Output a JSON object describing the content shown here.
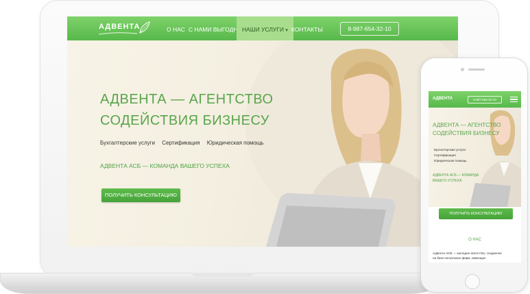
{
  "desktop": {
    "logo": "АДВЕНТА",
    "nav": {
      "items": [
        "О НАС",
        "С НАМИ ВЫГОДНО",
        "НАШИ УСЛУГИ",
        "КОНТАКТЫ"
      ],
      "dropdown_marker": "▾",
      "phone": "8-987-654-32-10"
    },
    "hero": {
      "title_line1": "АДВЕНТА — АГЕНТСТВО",
      "title_line2": "СОДЕЙСТВИЯ БИЗНЕСУ",
      "services": [
        "Бухгалтерские услуги",
        "Сертификация",
        "Юридическая помощь"
      ],
      "slogan": "АДВЕНТА АСБ — КОМАНДА ВАШЕГО УСПЕХА",
      "cta": "ПОЛУЧИТЬ КОНСУЛЬТАЦИЮ"
    }
  },
  "mobile": {
    "logo": "АДВЕНТА",
    "phone": "8-987-654-32-10",
    "hero": {
      "title_line1": "АДВЕНТА — АГЕНТСТВО",
      "title_line2": "СОДЕЙСТВИЯ БИЗНЕСУ",
      "services": [
        "Бухгалтерские услуги",
        "Сертификация",
        "Юридическая помощь"
      ],
      "slogan_line1": "АДВЕНТА АСБ — КОМАНДА",
      "slogan_line2": "ВАШЕГО УСПЕХА"
    },
    "cta": "ПОЛУЧИТЬ КОНСУЛЬТАЦИЮ",
    "about_title": "О НАС",
    "about_line1": "Адвента АСБ — молодое агентство, созданное",
    "about_line2": "на базе нескольких фирм, имеющих"
  },
  "colors": {
    "brand_green": "#57b84b",
    "accent_green_text": "#5aa54c",
    "nav_active": "#a7dd8c",
    "hero_background": "#f4efe1"
  }
}
